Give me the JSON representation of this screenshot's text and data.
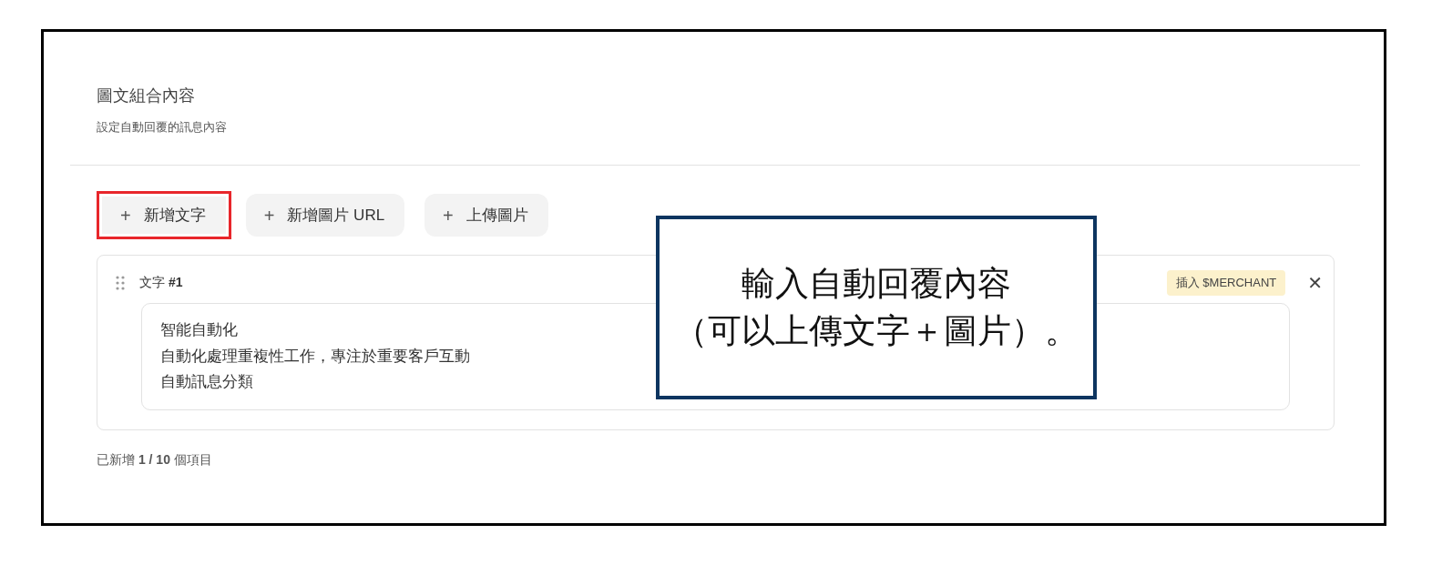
{
  "section": {
    "title": "圖文組合內容",
    "subtitle": "設定自動回覆的訊息內容"
  },
  "actions": [
    {
      "icon": "+",
      "label": "新增文字",
      "highlighted": true
    },
    {
      "icon": "+",
      "label": "新增圖片 URL",
      "highlighted": false
    },
    {
      "icon": "+",
      "label": "上傳圖片",
      "highlighted": false
    }
  ],
  "items": [
    {
      "label": "文字",
      "number": "#1",
      "insert_button": "插入 $MERCHANT",
      "close": "✕",
      "lines": [
        "智能自動化",
        "自動化處理重複性工作，專注於重要客戶互動",
        "自動訊息分類"
      ]
    }
  ],
  "count": {
    "prefix": "已新增",
    "value": "1 / 10",
    "suffix": "個項目"
  },
  "annotation": {
    "lines": [
      "輸入自動回覆內容",
      "（可以上傳文字＋圖片）。"
    ]
  }
}
